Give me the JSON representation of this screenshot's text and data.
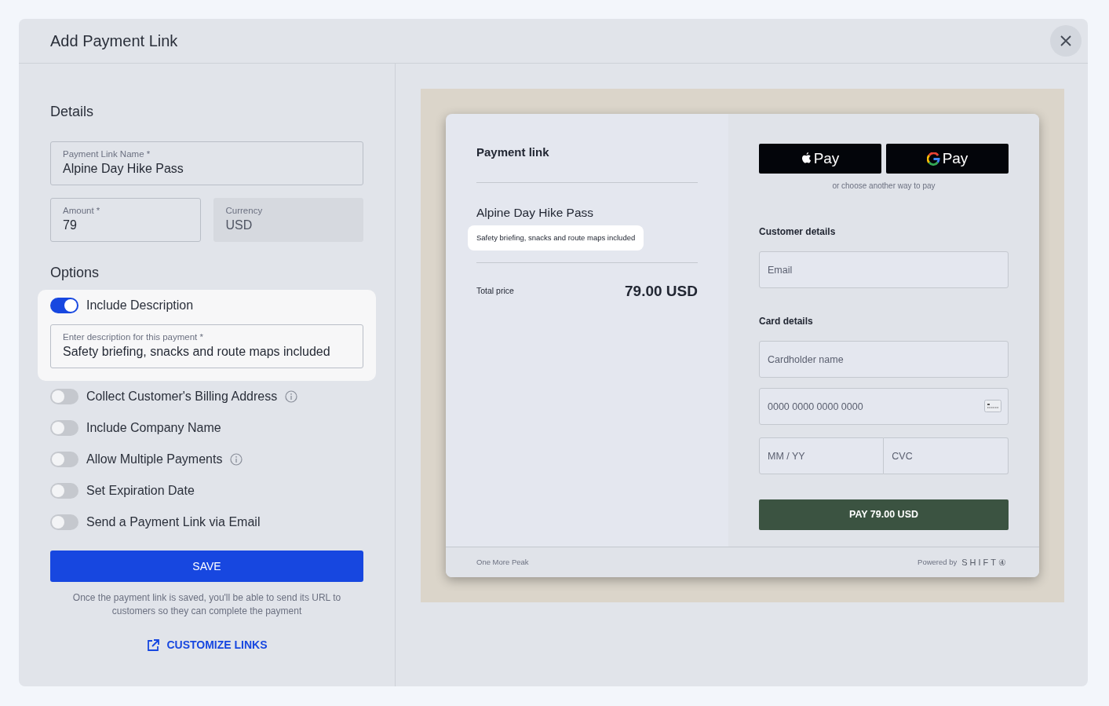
{
  "dialog": {
    "title": "Add Payment Link"
  },
  "details": {
    "heading": "Details",
    "fields": [
      {
        "label": "Payment Link Name *",
        "value": "Alpine Day Hike Pass",
        "disabled": false
      },
      {
        "label": "Amount *",
        "value": "79",
        "disabled": false
      },
      {
        "label": "Currency",
        "value": "USD",
        "disabled": true
      }
    ]
  },
  "options": {
    "heading": "Options",
    "items": [
      {
        "label": "Include Description",
        "on": true,
        "info": false,
        "field": {
          "label": "Enter description for this payment *",
          "value": "Safety briefing, snacks and route maps included"
        }
      },
      {
        "label": "Collect Customer's Billing Address",
        "on": false,
        "info": true
      },
      {
        "label": "Include Company Name",
        "on": false,
        "info": false
      },
      {
        "label": "Allow Multiple Payments",
        "on": false,
        "info": true
      },
      {
        "label": "Set Expiration Date",
        "on": false,
        "info": false
      },
      {
        "label": "Send a Payment Link via Email",
        "on": false,
        "info": false
      }
    ]
  },
  "save_button": "SAVE",
  "note": "Once the payment link is saved, you'll be able to send its URL to customers so they can complete the payment",
  "customize_link": "CUSTOMIZE LINKS",
  "preview": {
    "title": "Payment link",
    "product_name": "Alpine Day Hike Pass",
    "description": "Safety briefing, snacks and route maps included",
    "total_label": "Total price",
    "total": "79.00 USD",
    "wallet_buttons": [
      {
        "kind": "apple",
        "label": "Pay"
      },
      {
        "kind": "google",
        "label": "Pay"
      }
    ],
    "alt_text": "or choose another way to pay",
    "customer_heading": "Customer details",
    "email_placeholder": "Email",
    "card_heading": "Card details",
    "cardholder_placeholder": "Cardholder name",
    "card_number_placeholder": "0000 0000 0000 0000",
    "expiry_placeholder": "MM / YY",
    "cvc_placeholder": "CVC",
    "pay_button": "PAY 79.00 USD",
    "merchant": "One More Peak",
    "powered_by": "Powered by",
    "brand": "SHIFT④"
  }
}
